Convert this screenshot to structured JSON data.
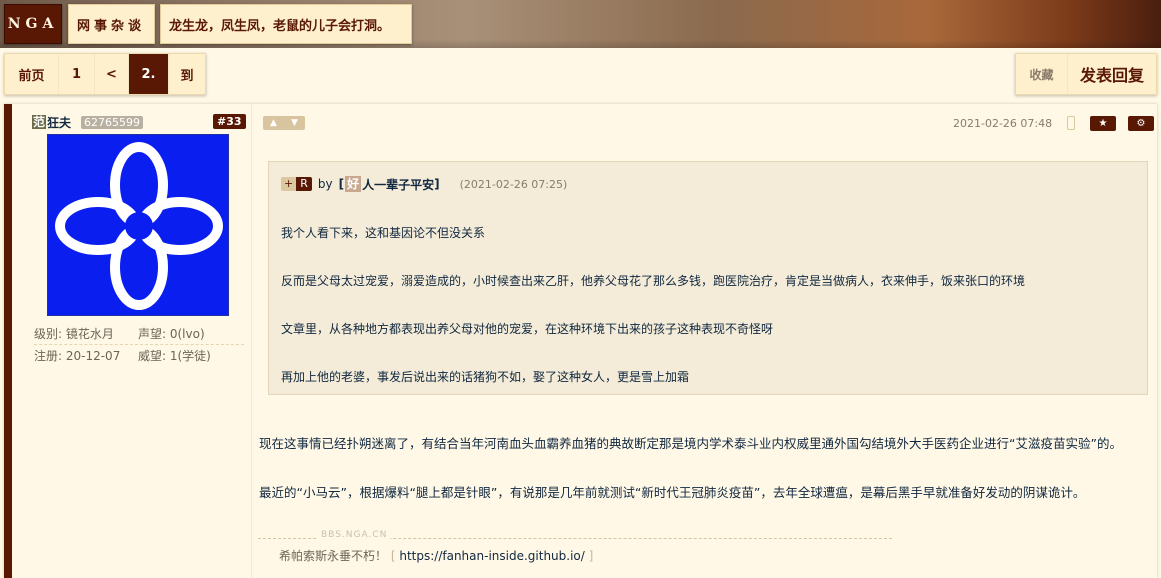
{
  "header": {
    "logo": "NGA",
    "breadcrumbs": [
      "网事杂谈",
      "龙生龙，凤生凤，老鼠的儿子会打洞。"
    ]
  },
  "pager": {
    "first": "前页",
    "page1": "1",
    "prev": "<",
    "current": "2.",
    "goto": "到"
  },
  "actions": {
    "favorite": "收藏",
    "reply": "发表回复"
  },
  "post": {
    "floor": "#33",
    "time": "2021-02-26 07:48",
    "author": {
      "mark": "范",
      "name": "狂夫",
      "uid": "62765599",
      "stats": [
        {
          "left": "级别: 镜花水月",
          "right": "声望: 0(lvo)"
        },
        {
          "left": "注册: 20-12-07",
          "right": "威望: 1(学徒)"
        }
      ]
    },
    "quote": {
      "plus": "+",
      "r": "R",
      "by": "by",
      "bracket_open": "[",
      "mark": "好",
      "name": "人一辈子平安",
      "bracket_close": "]",
      "time": "(2021-02-26 07:25)",
      "lines": [
        "我个人看下来，这和基因论不但没关系",
        "反而是父母太过宠爱，溺爱造成的，小时候查出来乙肝，他养父母花了那么多钱，跑医院治疗，肯定是当做病人，衣来伸手，饭来张口的环境",
        "文章里，从各种地方都表现出养父母对他的宠爱，在这种环境下出来的孩子这种表现不奇怪呀",
        "再加上他的老婆，事发后说出来的话猪狗不如，娶了这种女人，更是雪上加霜"
      ]
    },
    "body": [
      "现在这事情已经扑朔迷离了，有结合当年河南血头血霸养血猪的典故断定那是境内学术泰斗业内权威里通外国勾结境外大手医药企业进行“艾滋疫苗实验”的。",
      "最近的“小马云”，根据爆料“腿上都是针眼”，有说那是几年前就测试“新时代王冠肺炎疫苗”，去年全球遭瘟，是幕后黑手早就准备好发动的阴谋诡计。"
    ],
    "signature": {
      "watermark": "BBS.NGA.CN",
      "text": "希帕索斯永垂不朽！",
      "br_open": "[",
      "link": "https://fanhan-inside.github.io/",
      "br_close": "]"
    }
  }
}
